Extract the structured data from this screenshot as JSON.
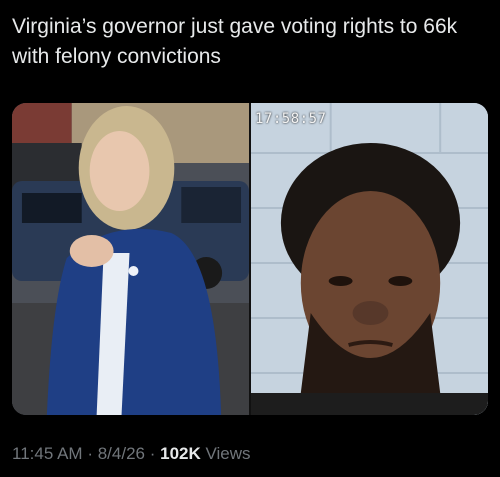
{
  "tweet": {
    "text": "Virginia’s governor just gave voting rights to 66k with felony convictions"
  },
  "media": {
    "left_image": "woman-in-blue-blazer-photo",
    "right_image": "mugshot-photo",
    "timestamp": "17:58:57"
  },
  "meta": {
    "time": "11:45 AM",
    "separator": "·",
    "date": "8/4/26",
    "views_count": "102K",
    "views_label": "Views"
  }
}
